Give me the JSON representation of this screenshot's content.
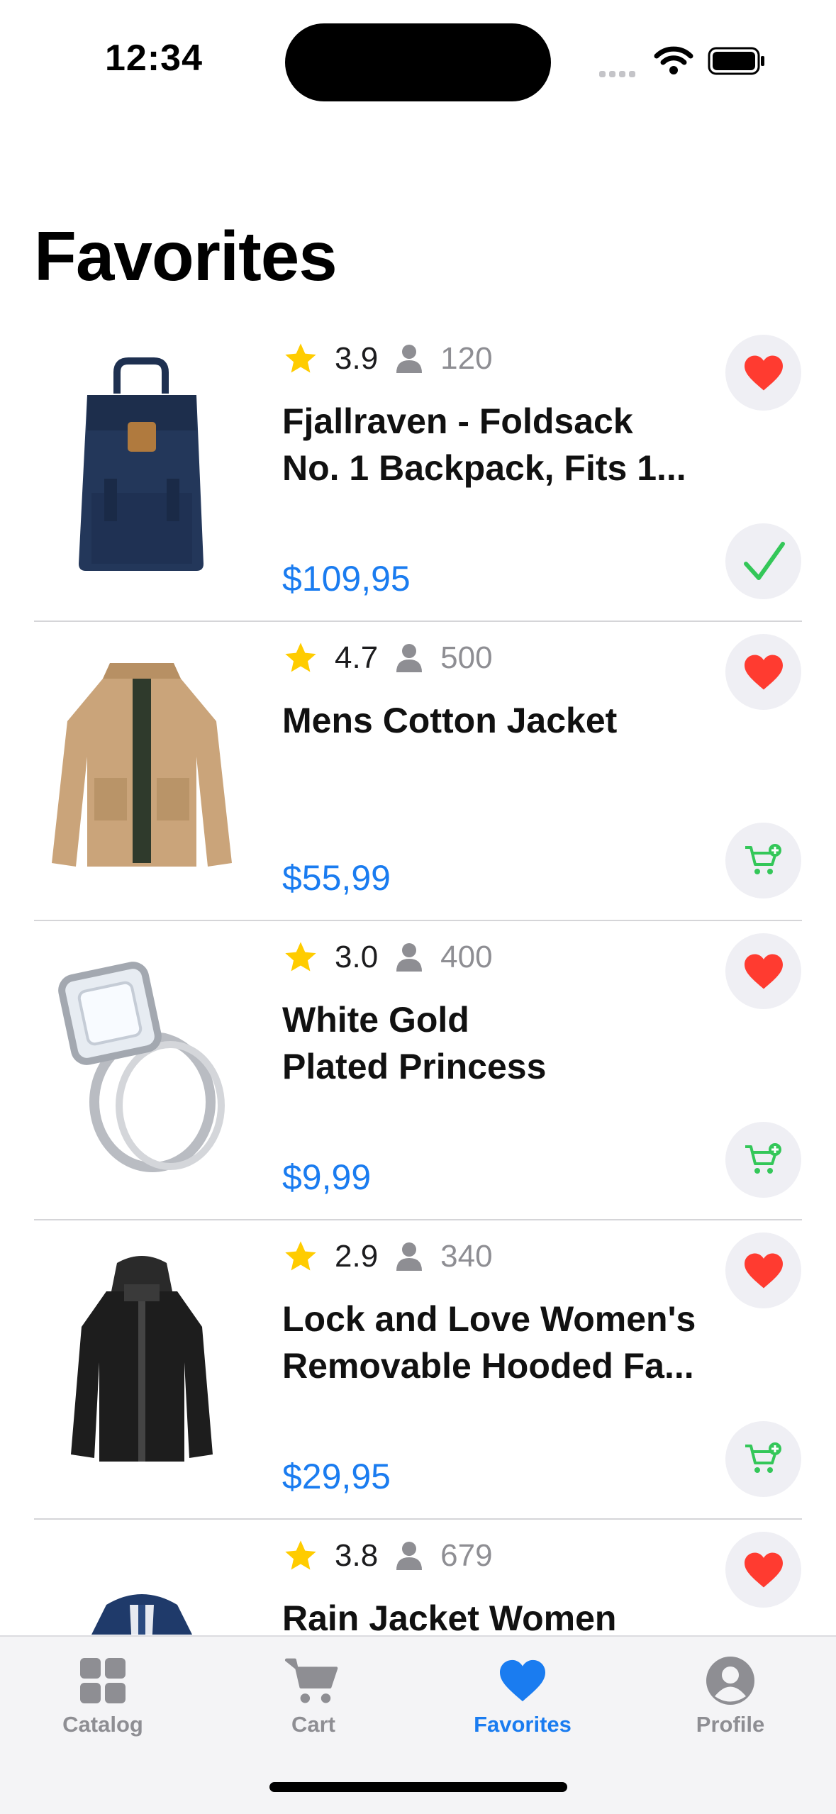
{
  "status_bar": {
    "time": "12:34"
  },
  "page": {
    "title": "Favorites"
  },
  "colors": {
    "accent": "#1a7cf0",
    "heart": "#ff3b30",
    "star": "#ffcc00",
    "cart": "#34c759",
    "check": "#34c759",
    "inactive": "#8e8e93"
  },
  "items": [
    {
      "rating": "3.9",
      "reviews": "120",
      "title_lines": [
        "Fjallraven - Foldsack",
        "No. 1 Backpack, Fits 1..."
      ],
      "price": "$109,95",
      "action_icon": "checkmark-icon",
      "image": "navy-backpack"
    },
    {
      "rating": "4.7",
      "reviews": "500",
      "title_lines": [
        "Mens Cotton Jacket"
      ],
      "price": "$55,99",
      "action_icon": "add-to-cart-icon",
      "image": "beige-cotton-jacket"
    },
    {
      "rating": "3.0",
      "reviews": "400",
      "title_lines": [
        "White Gold",
        "Plated Princess"
      ],
      "price": "$9,99",
      "action_icon": "add-to-cart-icon",
      "image": "diamond-ring"
    },
    {
      "rating": "2.9",
      "reviews": "340",
      "title_lines": [
        "Lock and Love Women's",
        "Removable Hooded Fa..."
      ],
      "price": "$29,95",
      "action_icon": "add-to-cart-icon",
      "image": "black-leather-jacket"
    },
    {
      "rating": "3.8",
      "reviews": "679",
      "title_lines": [
        "Rain Jacket Women"
      ],
      "price": "",
      "action_icon": "",
      "image": "navy-rain-jacket"
    }
  ],
  "tabs": [
    {
      "label": "Catalog",
      "icon": "grid-icon",
      "active": false
    },
    {
      "label": "Cart",
      "icon": "cart-icon",
      "active": false
    },
    {
      "label": "Favorites",
      "icon": "heart-icon",
      "active": true
    },
    {
      "label": "Profile",
      "icon": "profile-icon",
      "active": false
    }
  ]
}
